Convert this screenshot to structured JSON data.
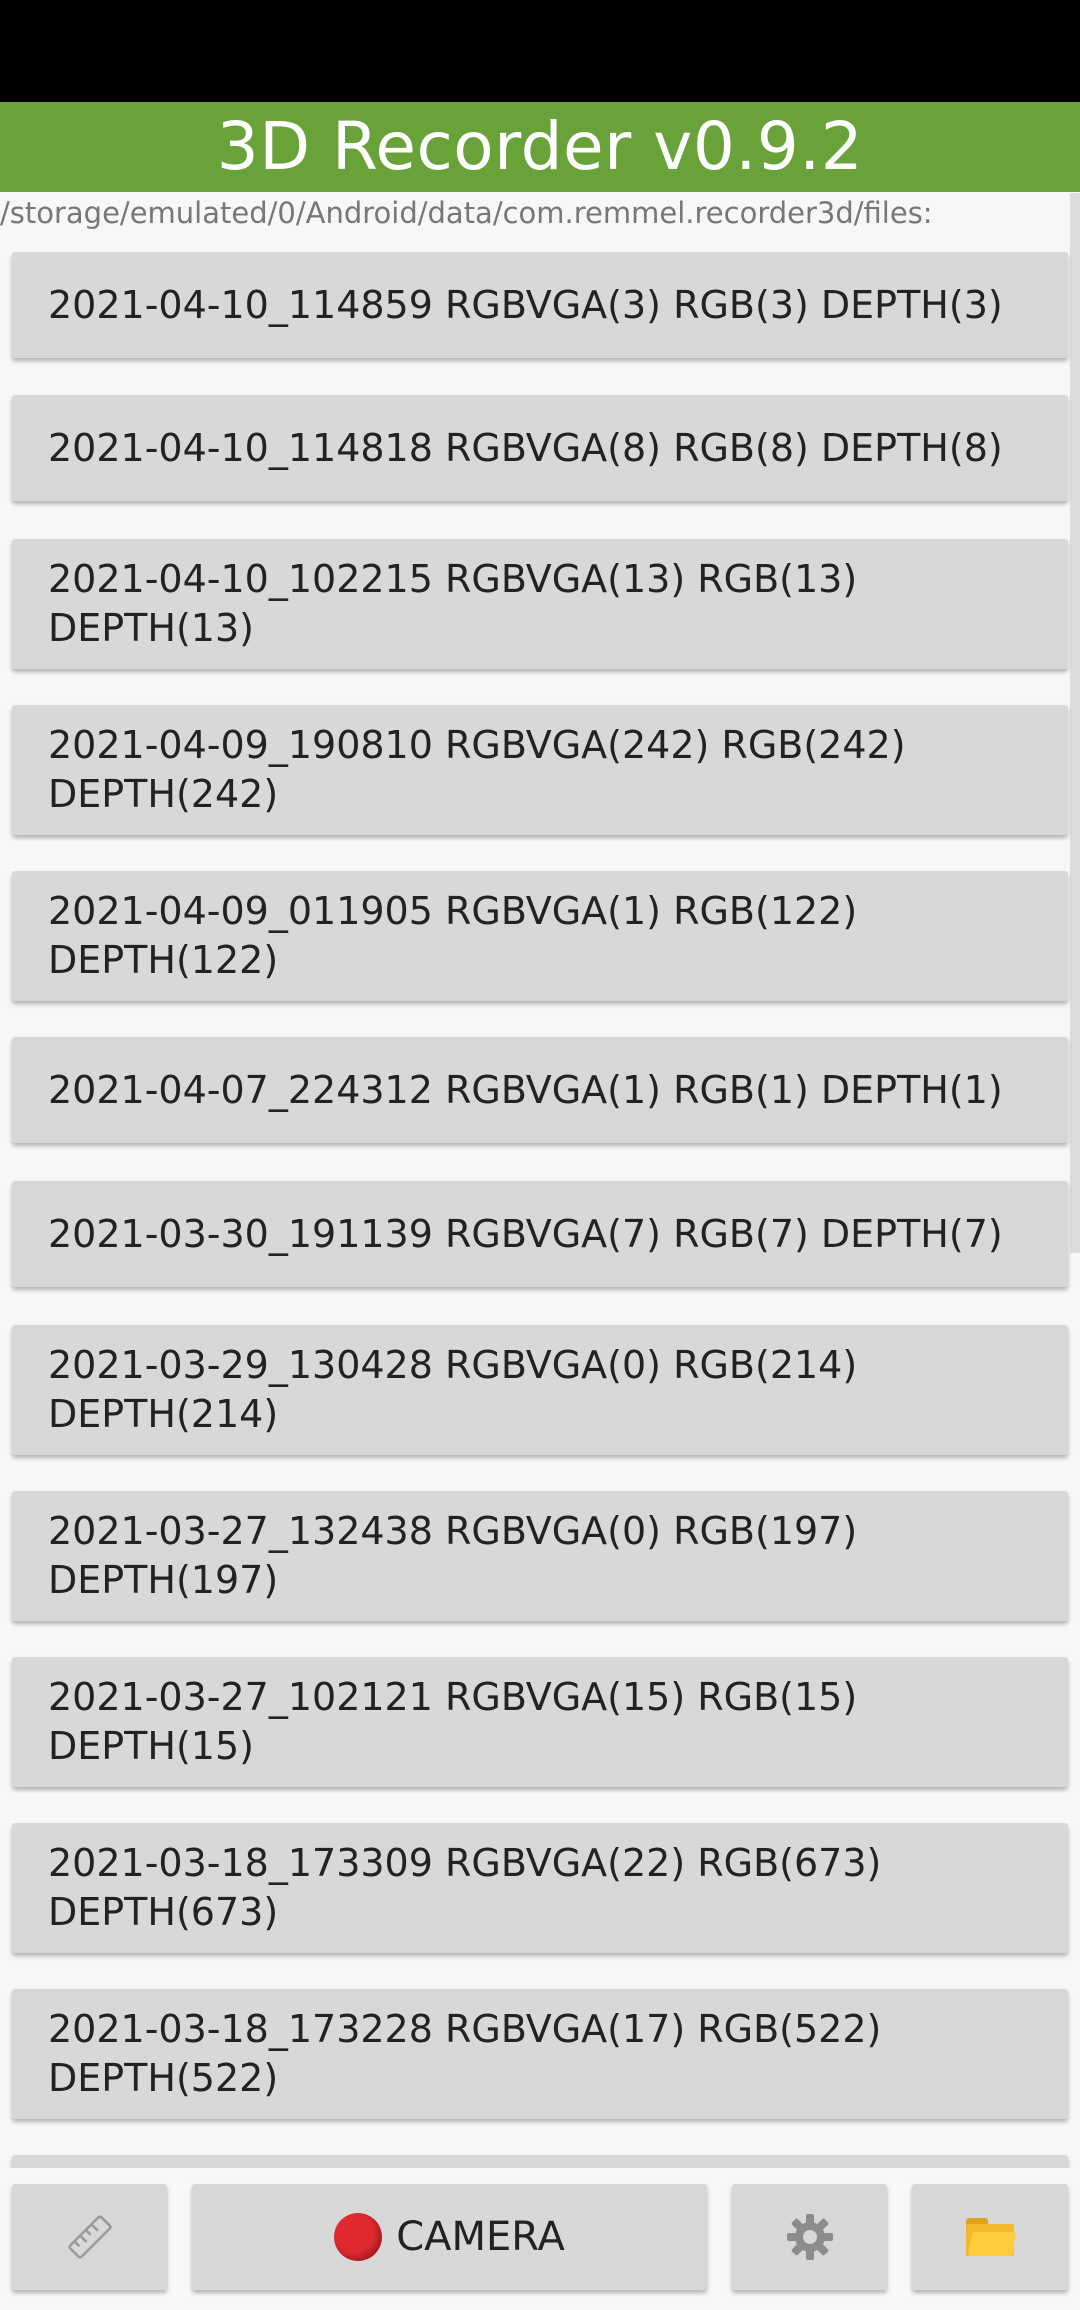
{
  "app": {
    "title": "3D Recorder v0.9.2"
  },
  "path": "/storage/emulated/0/Android/data/com.remmel.recorder3d/files:",
  "recordings": [
    {
      "line1": "2021-04-10_114859 RGBVGA(3) RGB(3) DEPTH(3)",
      "line2": ""
    },
    {
      "line1": "2021-04-10_114818 RGBVGA(8) RGB(8) DEPTH(8)",
      "line2": ""
    },
    {
      "line1": "2021-04-10_102215 RGBVGA(13) RGB(13)",
      "line2": "DEPTH(13)"
    },
    {
      "line1": "2021-04-09_190810 RGBVGA(242) RGB(242)",
      "line2": "DEPTH(242)"
    },
    {
      "line1": "2021-04-09_011905 RGBVGA(1) RGB(122)",
      "line2": "DEPTH(122)"
    },
    {
      "line1": "2021-04-07_224312 RGBVGA(1) RGB(1) DEPTH(1)",
      "line2": ""
    },
    {
      "line1": "2021-03-30_191139 RGBVGA(7) RGB(7) DEPTH(7)",
      "line2": ""
    },
    {
      "line1": "2021-03-29_130428 RGBVGA(0) RGB(214)",
      "line2": "DEPTH(214)"
    },
    {
      "line1": "2021-03-27_132438 RGBVGA(0) RGB(197)",
      "line2": "DEPTH(197)"
    },
    {
      "line1": "2021-03-27_102121 RGBVGA(15) RGB(15)",
      "line2": "DEPTH(15)"
    },
    {
      "line1": "2021-03-18_173309 RGBVGA(22) RGB(673)",
      "line2": "DEPTH(673)"
    },
    {
      "line1": "2021-03-18_173228 RGBVGA(17) RGB(522)",
      "line2": "DEPTH(522)"
    }
  ],
  "bottom_bar": {
    "camera_label": "CAMERA",
    "measure_icon": "ruler-icon",
    "settings_icon": "gear-icon",
    "folder_icon": "folder-icon",
    "record_icon": "record-dot-icon"
  },
  "colors": {
    "appbar": "#6aa23a",
    "button": "#d8d8d8",
    "record": "#e0282f"
  }
}
